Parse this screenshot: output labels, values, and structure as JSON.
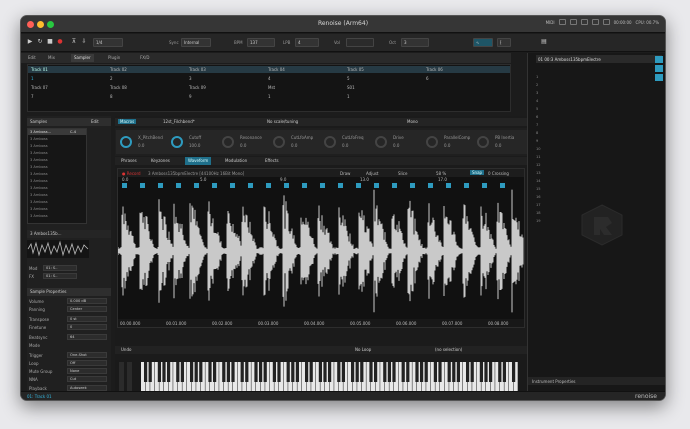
{
  "window": {
    "title": "Renoise (Arm64)"
  },
  "transport": {
    "pattern_value": "1/4",
    "sync_label": "Sync",
    "sync_value": "Internal",
    "bpm_label": "BPM",
    "bpm_value": "137",
    "lpb_label": "LPB",
    "lpb_value": "4",
    "vol_label": "Vol",
    "oct_label": "Oct",
    "oct_value": "3",
    "midi_label": "MIDI",
    "time_value": "00:00:00",
    "cpu_label": "CPU: 00.7%"
  },
  "tabs": [
    "Edit",
    "Mix",
    "Sampler",
    "Plugin",
    "FX/D"
  ],
  "tracks_row1": [
    "Track 01",
    "Track 02",
    "Track 03",
    "Track 04",
    "Track 05",
    "Track 06"
  ],
  "tracks_row1_vals": [
    "1",
    "2",
    "3",
    "4",
    "5",
    "6"
  ],
  "tracks_row2": [
    "Track 07",
    "Track 08",
    "Track 09",
    "Mst",
    "S01",
    ""
  ],
  "tracks_row2_vals": [
    "7",
    "8",
    "9",
    "1",
    "1",
    ""
  ],
  "samples": {
    "header": "Samples",
    "edit": "Edit",
    "items": [
      "3 Amboss...",
      "3 Amboss",
      "3 Amboss",
      "3 Amboss",
      "3 Amboss",
      "3 Amboss",
      "3 Amboss",
      "3 Amboss",
      "3 Amboss",
      "3 Amboss",
      "3 Amboss",
      "3 Amboss",
      "3 Amboss",
      "3 Amboss"
    ],
    "first_note": "C-4",
    "selected_name": "3 Ambos135b...",
    "mod_label": "Mod",
    "mod_value": "01: S..",
    "fx_label": "FX",
    "fx_value": "01: S..",
    "props_header": "Sample Properties",
    "props": [
      {
        "label": "Volume",
        "value": "0.000 dB"
      },
      {
        "label": "Panning",
        "value": "Center"
      },
      {
        "label": "Transpose",
        "value": "0 st"
      },
      {
        "label": "Finetune",
        "value": "0"
      },
      {
        "label": "Beatsync",
        "value": "64"
      },
      {
        "label": "Mode",
        "value": ""
      },
      {
        "label": "Trigger",
        "value": "One-Shot"
      },
      {
        "label": "Loop",
        "value": "Off"
      },
      {
        "label": "Mute Group",
        "value": "None"
      },
      {
        "label": "NNA",
        "value": "Cut"
      },
      {
        "label": "Playback",
        "value": "Autoseek"
      },
      {
        "label": "Interpol.",
        "value": "Sinc"
      }
    ]
  },
  "main": {
    "macros_label": "Macros",
    "instrument_name": "12st_Filchbend*",
    "scale_label": "No scale/tuning",
    "mono_label": "Mono",
    "macros": [
      {
        "name": "X_PitchBend",
        "value": "0.0"
      },
      {
        "name": "Cutoff",
        "value": "100.0"
      },
      {
        "name": "Resonance",
        "value": "0.0"
      },
      {
        "name": "CutLfoAmp",
        "value": "0.0"
      },
      {
        "name": "CutLfoFreq",
        "value": "0.0"
      },
      {
        "name": "Drive",
        "value": "0.0"
      },
      {
        "name": "ParallelComp",
        "value": "0.0"
      },
      {
        "name": "PB Inertia",
        "value": "0.0"
      }
    ],
    "subtabs": [
      "Phrases",
      "Keyzones",
      "Waveform",
      "Modulation",
      "Effects"
    ],
    "record_label": "Record",
    "sample_file": "3 Amboss135bpmElectre [44100Hz 16Bit Mono]",
    "draw_label": "Draw",
    "adjust_label": "Adjust",
    "slice_label": "Slice",
    "zoom_value": "58 %",
    "snap_label": "Snap",
    "zero_label": "0 Crossing",
    "ruler": [
      "0.0",
      "5.0",
      "9.0",
      "13.0",
      "17.0"
    ],
    "times": [
      "00.00.000",
      "00.01.000",
      "00.02.000",
      "00.03.000",
      "00.04.000",
      "00.05.000",
      "00.06.000",
      "00.07.000",
      "00.08.000"
    ],
    "undo_label": "Undo",
    "noloop_label": "No Loop",
    "noselection_label": "(no selection)"
  },
  "right": {
    "track_name": "01 00:3 Amboss135bpmElectre",
    "rows": [
      "1",
      "2",
      "3",
      "4",
      "5",
      "6",
      "7",
      "8",
      "9",
      "10",
      "11",
      "12",
      "13",
      "14",
      "15",
      "16",
      "17",
      "18",
      "19"
    ],
    "footer": "Instrument Properties"
  },
  "status": {
    "text": "01: Track 01",
    "brand": "renoise"
  },
  "colors": {
    "accent": "#35b6df",
    "background": "#1c1c1c"
  }
}
